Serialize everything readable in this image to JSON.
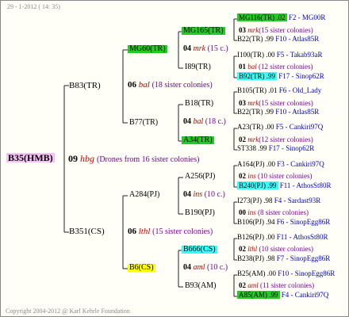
{
  "header": "29 - 1-2012 ( 14: 35)",
  "footer": "Copyright 2004-2012 @ Karl Kehrle Foundation",
  "colors": {
    "green": "#22cc22",
    "pink": "#f5c2f5",
    "yellow": "#ffff00",
    "cyan": "#33ffff",
    "line": "#222222"
  },
  "root": {
    "label": "B35(HMB)",
    "num": "09",
    "code": "hbg",
    "note": "(Drones from 16 sister colonies)"
  },
  "gen1": [
    {
      "label": "B83(TR)",
      "num": "06",
      "code": "bal",
      "note": "(18 sister colonies)"
    },
    {
      "label": "B351(CS)",
      "num": "06",
      "code": "lthl",
      "note": "(15 sister colonies)"
    }
  ],
  "gen2": [
    {
      "label": "MG60(TR)",
      "num": "04",
      "code": "mrk",
      "note": "(15 c.)"
    },
    {
      "label": "B77(TR)",
      "num": "04",
      "code": "bal",
      "note": "(18 c.)"
    },
    {
      "label": "A284(PJ)",
      "num": "04",
      "code": "ins",
      "note": "(10 c.)"
    },
    {
      "label": "B6(CS)",
      "num": "04",
      "code": "aml",
      "note": "(10 c.)"
    }
  ],
  "gen3": [
    {
      "label": "MG165(TR)",
      "num": "03",
      "code": "mrk",
      "note": "(15 sister colonies)"
    },
    {
      "label": "I89(TR)",
      "num": "01",
      "code": "bal",
      "note": "(12 sister colonies)"
    },
    {
      "label": "B18(TR)",
      "num": "03",
      "code": "mrk",
      "note": "(15 sister colonies)"
    },
    {
      "label": "A34(TR)",
      "num": "02",
      "code": "mrk",
      "note": "(12 sister colonies)"
    },
    {
      "label": "A256(PJ)",
      "num": "02",
      "code": "ins",
      "note": "(10 sister colonies)"
    },
    {
      "label": "B190(PJ)",
      "num": "00",
      "code": "ins",
      "note": "(8 sister colonies)"
    },
    {
      "label": "B666(CS)",
      "num": "02",
      "code": "lthl",
      "note": "(10 sister colonies)"
    },
    {
      "label": "B93(AM)",
      "num": "02",
      "code": "aml",
      "note": "(11 sister colonies)"
    }
  ],
  "gen4": [
    {
      "name": "MG116(TR)",
      "val": ".02",
      "id": "F2 - MG00R"
    },
    {
      "name": "B22(TR)",
      "val": ".99",
      "id": "F10 - Atlas85R"
    },
    {
      "name": "I100(TR)",
      "val": ".00",
      "id": "F5 - Takab93aR"
    },
    {
      "name": "B92(TR)",
      "val": ".99",
      "id": "F17 - Sinop62R"
    },
    {
      "name": "B105(TR)",
      "val": ".01",
      "id": "F6 - Old_Lady"
    },
    {
      "name": "B22(TR)",
      "val": ".99",
      "id": "F10 - Atlas85R"
    },
    {
      "name": "A23(TR)",
      "val": ".00",
      "id": "F5 - Cankiri97Q"
    },
    {
      "name": "ST338",
      "val": ".99",
      "id": "F17 - Sinop62R"
    },
    {
      "name": "A164(PJ)",
      "val": ".00",
      "id": "F3 - Cankiri97Q"
    },
    {
      "name": "B240(PJ)",
      "val": ".99",
      "id": "F11 - AthosSt80R"
    },
    {
      "name": "I273(PJ)",
      "val": ".98",
      "id": "F4 - Sardast93R"
    },
    {
      "name": "B106(PJ)",
      "val": ".94",
      "id": "F6 - SinopEgg86R"
    },
    {
      "name": "B126(PJ)",
      "val": ".00",
      "id": "F11 - AthosSt80R"
    },
    {
      "name": "B238(PJ)",
      "val": ".98",
      "id": "F7 - SinopEgg86R"
    },
    {
      "name": "B25(AM)",
      "val": ".00",
      "id": "F10 - SinopEgg86R"
    },
    {
      "name": "A85(AM)",
      "val": ".99",
      "id": "F4 - Cankiri97Q"
    }
  ]
}
